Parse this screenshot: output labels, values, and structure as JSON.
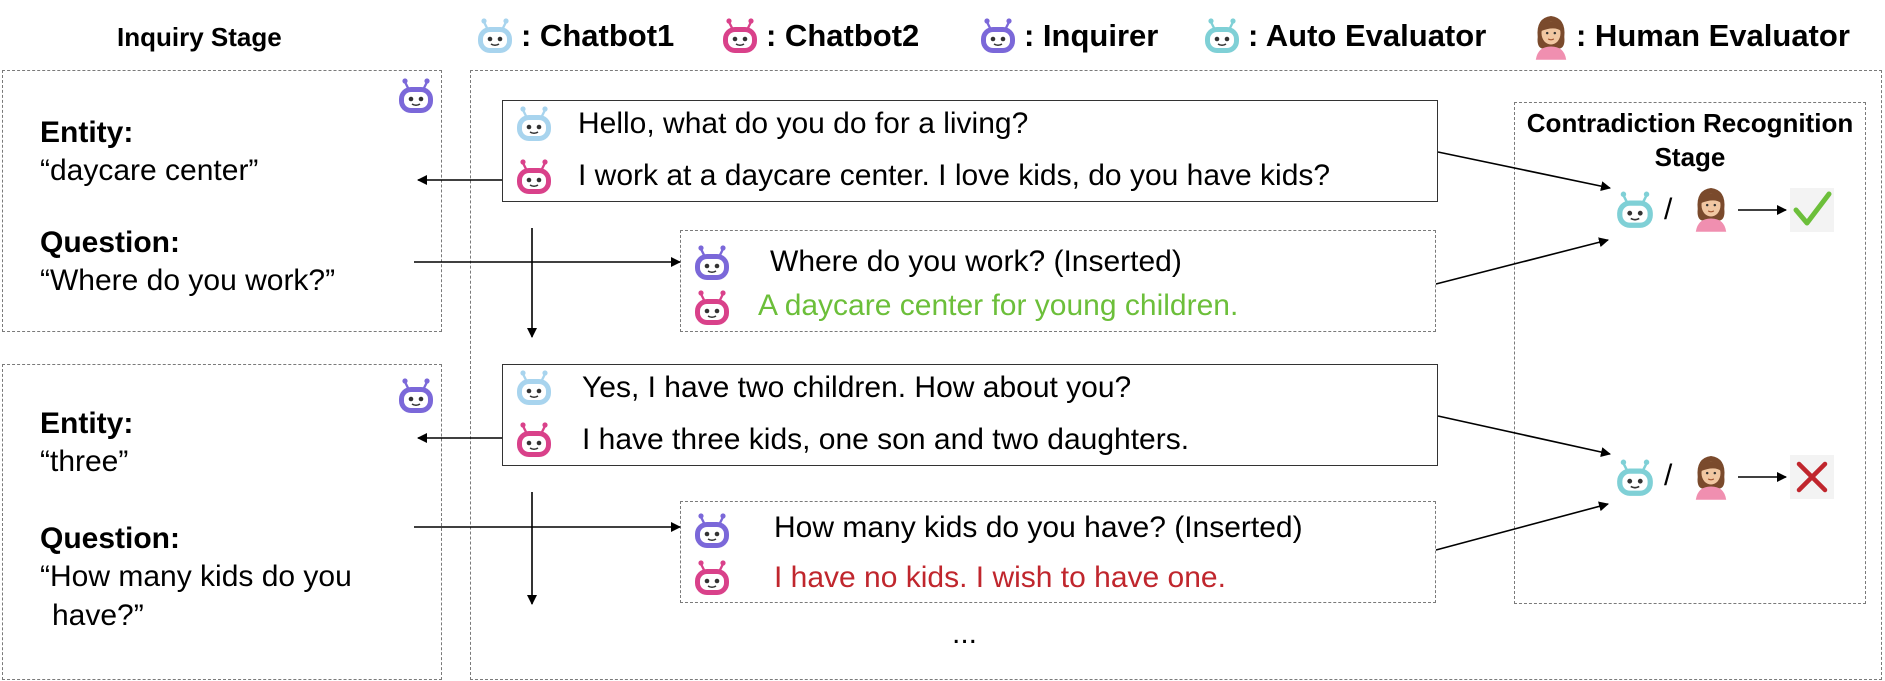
{
  "legend": {
    "chatbot1": ": Chatbot1",
    "chatbot2": ": Chatbot2",
    "inquirer": ": Inquirer",
    "auto": ": Auto Evaluator",
    "human": ": Human Evaluator"
  },
  "inquiry_stage": {
    "title": "Inquiry Stage",
    "panels": [
      {
        "entity_label": "Entity:",
        "entity": "“daycare center”",
        "question_label": "Question:",
        "question": "“Where do you work?”"
      },
      {
        "entity_label": "Entity:",
        "entity": "“three”",
        "question_label": "Question:",
        "question_line1": "“How many kids do you",
        "question_line2": "have?”"
      }
    ]
  },
  "dialogue": {
    "turns": [
      {
        "chatbot1": "Hello, what do you do for a living?",
        "chatbot2": "I work at a daycare center. I love kids, do you have kids?"
      },
      {
        "inquirer": "Where do you work? (Inserted)",
        "chatbot2_answer": "A daycare center for young children."
      },
      {
        "chatbot1": "Yes, I have two children. How about you?",
        "chatbot2": "I have three kids, one son and two daughters."
      },
      {
        "inquirer": "How many kids do you have? (Inserted)",
        "chatbot2_answer": "I have no kids. I wish to have one."
      }
    ],
    "ellipsis": "..."
  },
  "contradiction_stage": {
    "title_line1": "Contradiction Recognition",
    "title_line2": "Stage",
    "slash": "/",
    "results": [
      "consistent",
      "contradiction"
    ]
  },
  "colors": {
    "chatbot1": "#a8d4ee",
    "chatbot2": "#d9418a",
    "inquirer": "#7b68d9",
    "auto": "#7fd0d6",
    "consistent": "#6cbf3a",
    "contradiction": "#c0262d"
  }
}
